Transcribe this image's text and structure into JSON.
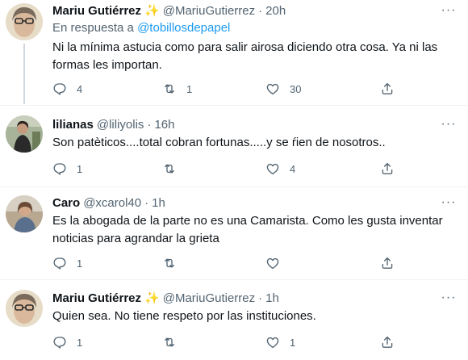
{
  "tweets": [
    {
      "name": "Mariu Gutiérrez",
      "emoji": "✨",
      "handle": "@MariuGutierrez",
      "time": "20h",
      "reply_prefix": "En respuesta a",
      "reply_to": "@tobillosdepapel",
      "text": "Ni la mínima astucia como para salir airosa diciendo otra cosa. Ya ni las formas les importan.",
      "replies": "4",
      "retweets": "1",
      "likes": "30"
    },
    {
      "name": "lilianas",
      "handle": "@liliyolis",
      "time": "16h",
      "text": "Son patèticos....total cobran fortunas.....y se ŕien de nosotros..",
      "replies": "1",
      "retweets": "",
      "likes": "4"
    },
    {
      "name": "Caro",
      "handle": "@xcarol40",
      "time": "1h",
      "text": "Es la abogada de la parte no es una Camarista. Como les gusta inventar noticias para agrandar la grieta",
      "replies": "1",
      "retweets": "",
      "likes": ""
    },
    {
      "name": "Mariu Gutiérrez",
      "emoji": "✨",
      "handle": "@MariuGutierrez",
      "time": "1h",
      "text": "Quien sea. No tiene respeto por las instituciones.",
      "replies": "1",
      "retweets": "",
      "likes": "1"
    }
  ],
  "separator": "·",
  "more_label": "···",
  "icons": {
    "reply": "reply-icon",
    "retweet": "retweet-icon",
    "like": "heart-icon",
    "share": "share-icon",
    "more": "more-icon"
  },
  "colors": {
    "link": "#1d9bf0",
    "secondary": "#536471",
    "text": "#0f1419",
    "sparkle": "#f4b400"
  }
}
